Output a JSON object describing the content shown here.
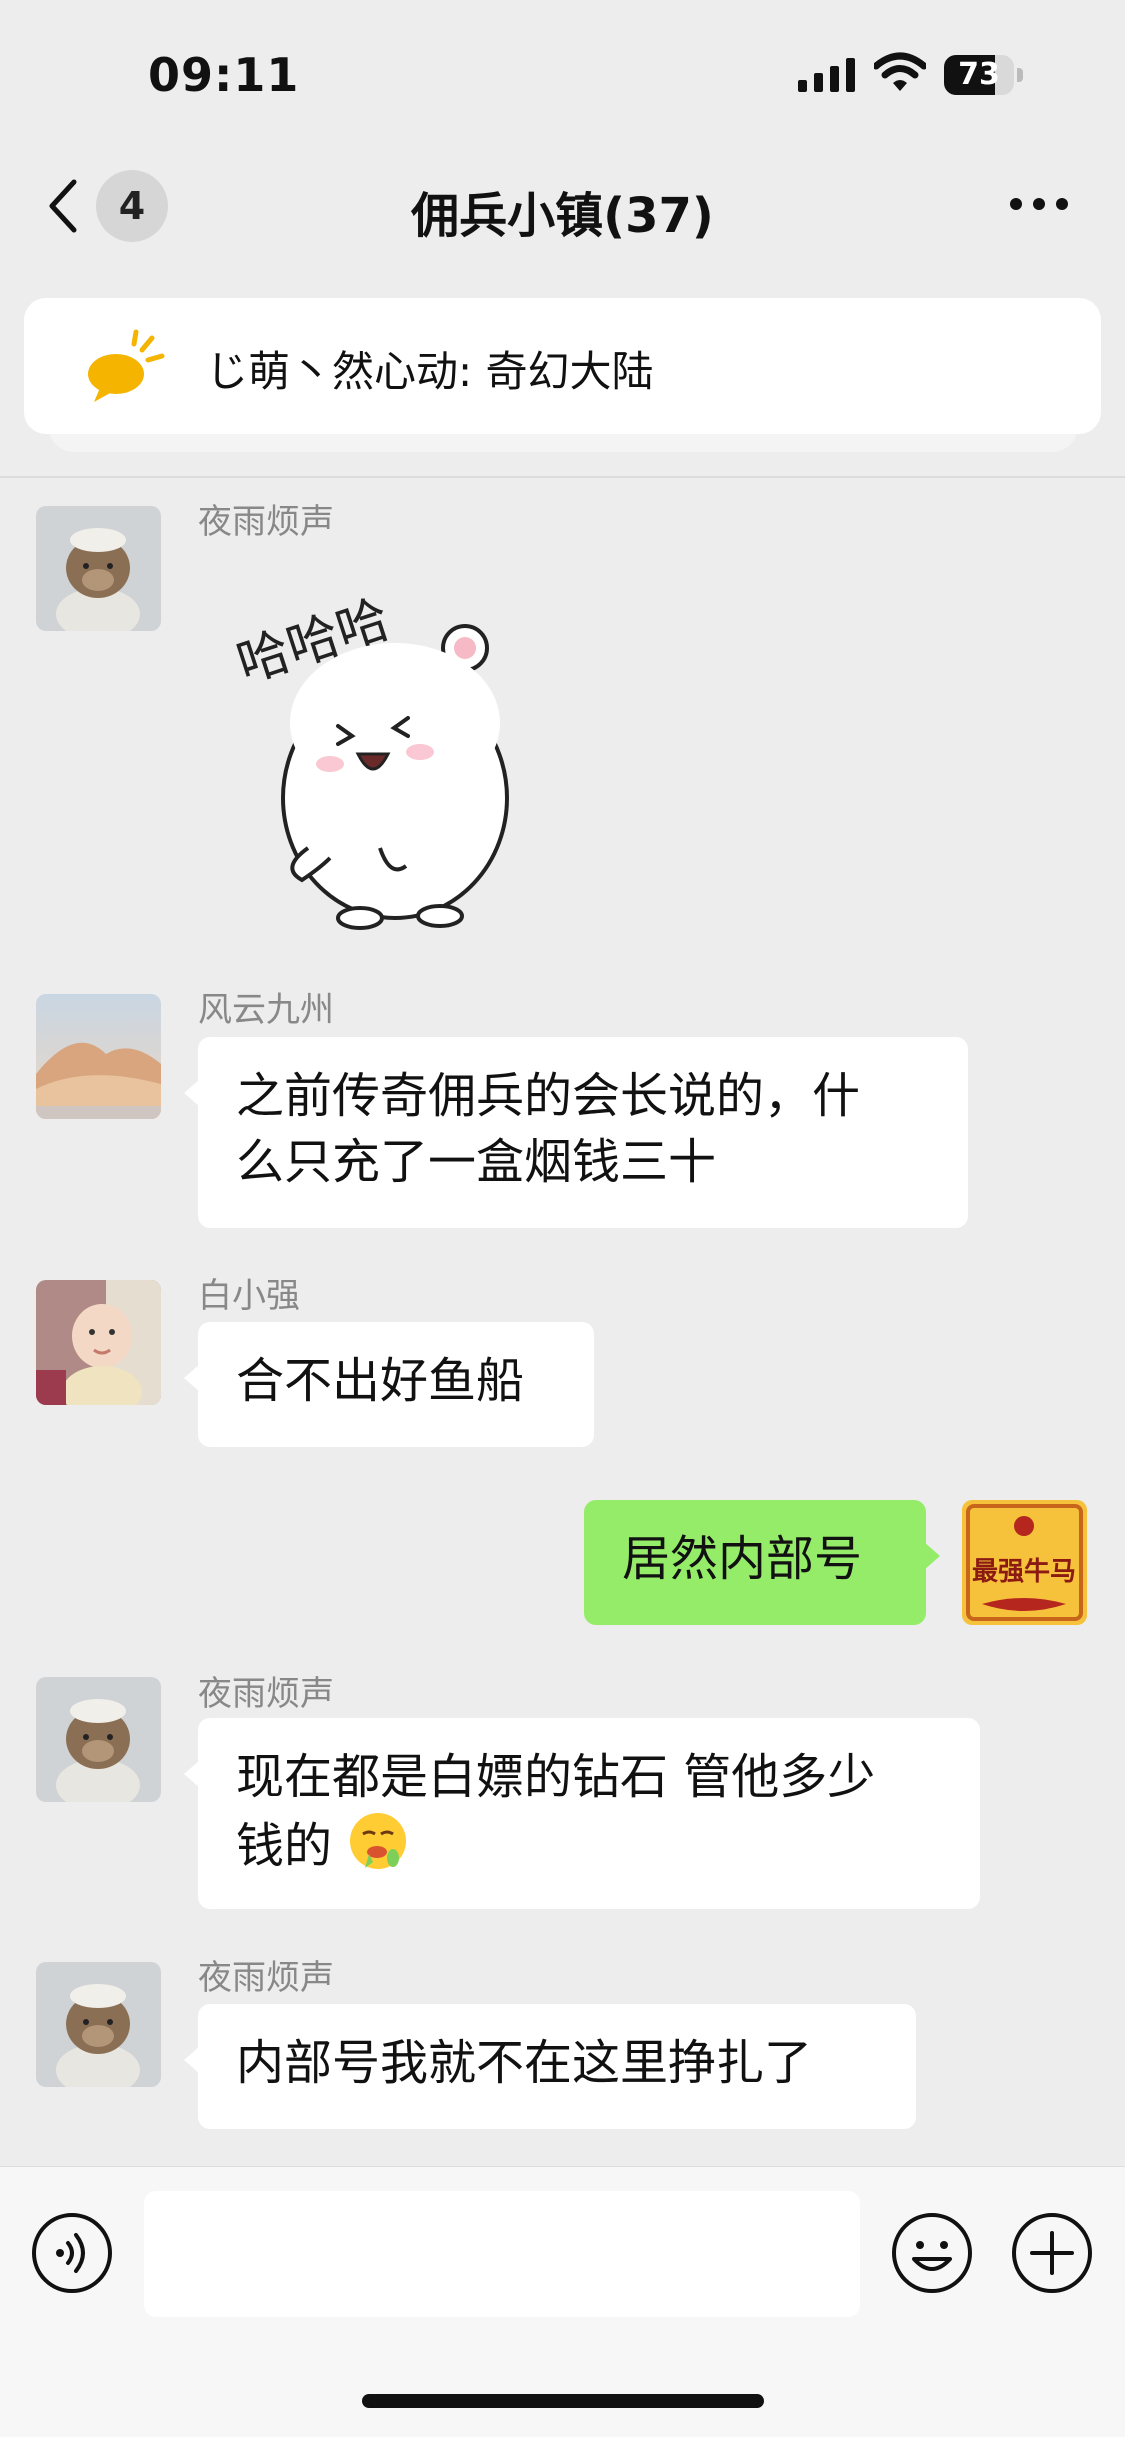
{
  "status_bar": {
    "time": "09:11",
    "battery": "73",
    "battery_level": 0.73
  },
  "nav": {
    "back_count": "4",
    "title": "佣兵小镇(37)"
  },
  "pinned": {
    "text": "じ萌丶然心动: 奇幻大陆"
  },
  "messages": [
    {
      "sender": "夜雨烦声",
      "type": "sticker",
      "sticker_text": "哈哈哈"
    },
    {
      "sender": "风云九州",
      "type": "text",
      "lines": [
        "之前传奇佣兵的会长说的，什",
        "么只充了一盒烟钱三十"
      ]
    },
    {
      "sender": "白小强",
      "type": "text",
      "lines": [
        "合不出好鱼船"
      ]
    },
    {
      "sender": "self",
      "type": "text",
      "lines": [
        "居然内部号"
      ],
      "avatar_text": "最强牛马"
    },
    {
      "sender": "夜雨烦声",
      "type": "text",
      "lines": [
        "现在都是白嫖的钻石 管他多少",
        "钱的"
      ],
      "emoji": "drooling-face"
    },
    {
      "sender": "夜雨烦声",
      "type": "text",
      "lines": [
        "内部号我就不在这里挣扎了"
      ]
    }
  ],
  "input": {
    "placeholder": ""
  },
  "colors": {
    "background": "#ededed",
    "bubble_self": "#95ec69",
    "bubble_other": "#ffffff",
    "pin_icon": "#f5b400"
  },
  "icons": [
    "back-arrow",
    "more-dots",
    "megaphone",
    "voice",
    "emoji-smile",
    "plus-circle"
  ]
}
